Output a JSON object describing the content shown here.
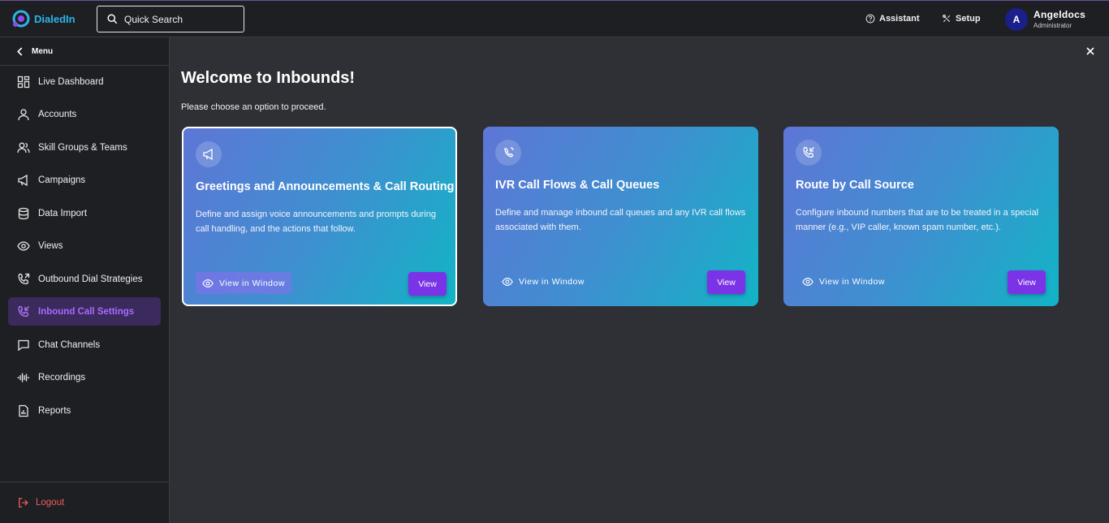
{
  "app": {
    "name": "DialedIn"
  },
  "header": {
    "search_placeholder": "Quick Search",
    "assistant_label": "Assistant",
    "setup_label": "Setup",
    "user": {
      "initial": "A",
      "name": "Angeldocs",
      "role": "Administrator"
    }
  },
  "sidebar": {
    "menu_label": "Menu",
    "items": [
      {
        "label": "Live Dashboard",
        "icon": "dashboard-icon"
      },
      {
        "label": "Accounts",
        "icon": "user-icon"
      },
      {
        "label": "Skill Groups & Teams",
        "icon": "users-icon"
      },
      {
        "label": "Campaigns",
        "icon": "megaphone-icon"
      },
      {
        "label": "Data Import",
        "icon": "database-icon"
      },
      {
        "label": "Views",
        "icon": "eye-icon"
      },
      {
        "label": "Outbound Dial Strategies",
        "icon": "phone-outgoing-icon"
      },
      {
        "label": "Inbound Call Settings",
        "icon": "phone-incoming-icon",
        "active": true
      },
      {
        "label": "Chat Channels",
        "icon": "chat-icon"
      },
      {
        "label": "Recordings",
        "icon": "waveform-icon"
      },
      {
        "label": "Reports",
        "icon": "report-icon"
      }
    ],
    "logout_label": "Logout"
  },
  "main": {
    "title": "Welcome to Inbounds!",
    "subtitle": "Please choose an option to proceed.",
    "cards": [
      {
        "title": "Greetings and Announcements & Call Routing",
        "description": "Define and assign voice announcements and prompts during call handling, and the actions that follow.",
        "view_window_label": "View in Window",
        "view_label": "View",
        "selected": true
      },
      {
        "title": "IVR Call Flows & Call Queues",
        "description": "Define and manage inbound call queues and any IVR call flows associated with them.",
        "view_window_label": "View in Window",
        "view_label": "View",
        "selected": false
      },
      {
        "title": "Route by Call Source",
        "description": "Configure inbound numbers that are to be treated in a special manner (e.g., VIP caller, known spam number, etc.).",
        "view_window_label": "View in Window",
        "view_label": "View",
        "selected": false
      }
    ]
  },
  "colors": {
    "accent": "#7a33e6",
    "active_nav_bg": "#3b2a5c",
    "active_nav_text": "#a86bff",
    "logout": "#ef5b5b"
  }
}
